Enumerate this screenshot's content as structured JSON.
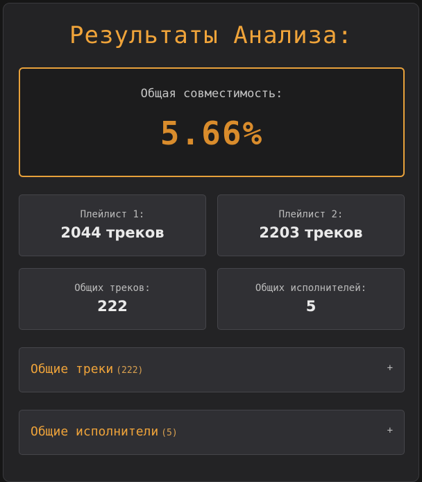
{
  "title": "Результаты Анализа:",
  "compatibility": {
    "label": "Общая совместимость:",
    "value": "5.66%"
  },
  "stats": [
    {
      "label": "Плейлист 1:",
      "value": "2044 треков"
    },
    {
      "label": "Плейлист 2:",
      "value": "2203 треков"
    },
    {
      "label": "Общих треков:",
      "value": "222"
    },
    {
      "label": "Общих исполнителей:",
      "value": "5"
    }
  ],
  "sections": [
    {
      "title": "Общие треки",
      "count": "(222)",
      "toggle": "+"
    },
    {
      "title": "Общие исполнители",
      "count": "(5)",
      "toggle": "+"
    }
  ],
  "colors": {
    "accent": "#f0a43a",
    "background": "#232325",
    "card": "#303034"
  }
}
